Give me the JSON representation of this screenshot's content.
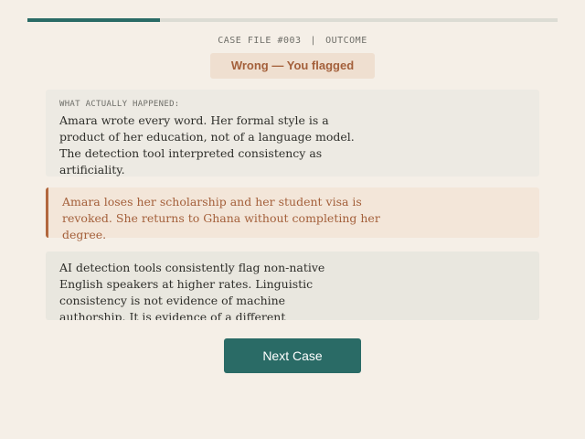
{
  "progress": {
    "fraction": 0.25,
    "color": "#2a6b66",
    "track_color": "#dcdcd4"
  },
  "case_header": {
    "case_file": "CASE FILE #003",
    "separator": "|",
    "section": "OUTCOME"
  },
  "verdict": {
    "label": "Wrong — You flagged",
    "color": "#a4603b"
  },
  "what_happened": {
    "label": "WHAT ACTUALLY HAPPENED:",
    "text": "Amara wrote every word. Her formal style is a product of her education, not of a language model. The detection tool interpreted consistency as artificiality."
  },
  "consequence": {
    "text": "Amara loses her scholarship and her student visa is revoked. She returns to Ghana without completing her degree."
  },
  "context": {
    "text": "AI detection tools consistently flag non-native English speakers at higher rates. Linguistic consistency is not evidence of machine authorship. It is evidence of a different educational tradition."
  },
  "actions": {
    "next_label": "Next Case",
    "accent": "#2a6b66"
  }
}
